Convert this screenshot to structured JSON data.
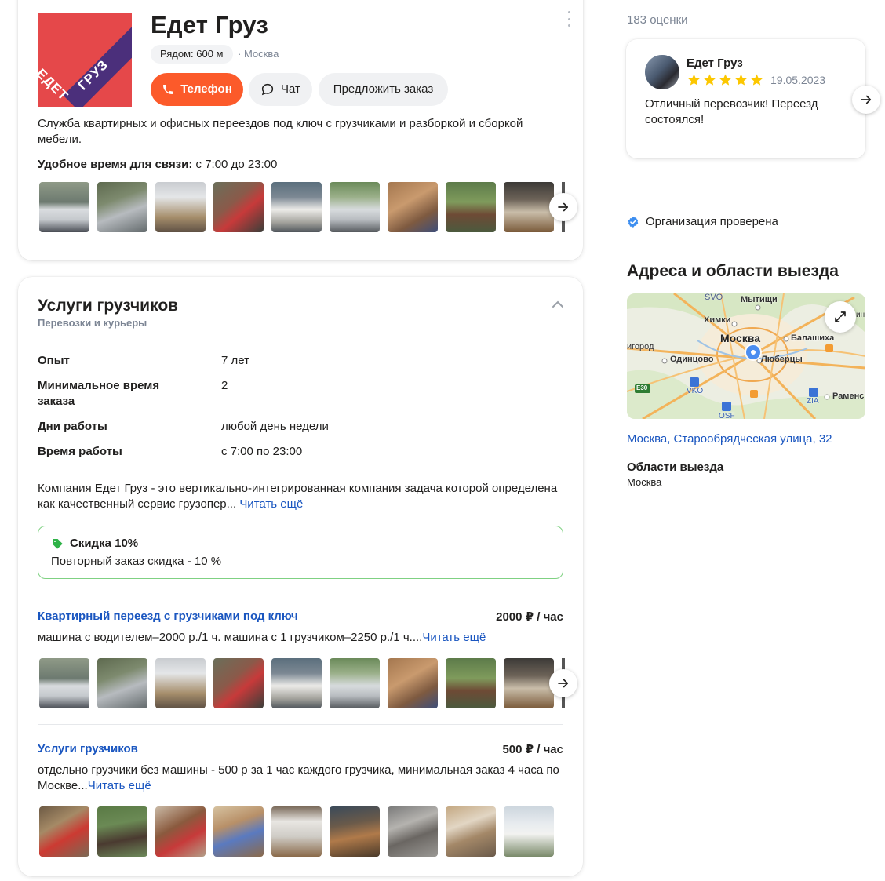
{
  "company": {
    "name": "Едет Груз",
    "logo_text_1": "ЕДЕТ",
    "logo_text_2": "ГРУЗ",
    "nearby": "Рядом: 600 м",
    "city": "· Москва",
    "description": "Служба квартирных и офисных переездов под ключ с грузчиками и разборкой и сборкой мебели.",
    "contact_time_label": "Удобное время для связи:",
    "contact_time_value": " с 7:00 до 23:00"
  },
  "actions": {
    "phone": "Телефон",
    "chat": "Чат",
    "order": "Предложить заказ"
  },
  "services_section": {
    "title": "Услуги грузчиков",
    "subtitle": "Перевозки и курьеры",
    "info": [
      {
        "key": "Опыт",
        "value": "7 лет"
      },
      {
        "key": "Минимальное время заказа",
        "value": "2"
      },
      {
        "key": "Дни работы",
        "value": "любой день недели"
      },
      {
        "key": "Время работы",
        "value": "с 7:00 по 23:00"
      }
    ],
    "about": "Компания Едет Груз - это вертикально-интегрированная компания задача которой определена как качественный сервис грузопер...",
    "read_more": "Читать ещё",
    "discount_title": "Скидка 10%",
    "discount_text": "Повторный заказ скидка - 10 %",
    "services": [
      {
        "name": "Квартирный переезд с грузчиками под ключ",
        "price": "2000 ₽ / час",
        "desc": "машина с водителем–2000 р./1 ч. машина с 1 грузчиком–2250 р./1 ч....",
        "read_more": "Читать ещё"
      },
      {
        "name": "Услуги грузчиков",
        "price": "500 ₽ / час",
        "desc": "отдельно грузчики без машины - 500 р за 1 час каждого грузчика, минимальная заказ 4 часа по Москве...",
        "read_more": "Читать ещё"
      }
    ]
  },
  "sidebar": {
    "ratings_count": "183 оценки",
    "review": {
      "author": "Едет Груз",
      "rating": 5,
      "date": "19.05.2023",
      "text": "Отличный перевозчик! Переезд состоялся!"
    },
    "verified": "Организация проверена",
    "address_title": "Адреса и области выезда",
    "address": "Москва, Старообрядческая улица, 32",
    "areas_title": "Области выезда",
    "areas_value": "Москва",
    "map_labels": [
      "SVO",
      "Мытищи",
      "Химки",
      "Москва",
      "Балашиха",
      "игород",
      "Одинцово",
      "Люберцы",
      "E30",
      "VKO",
      "ZIA",
      "Раменск",
      "OSF",
      "ин"
    ]
  },
  "colors": {
    "accent": "#fc5a2a",
    "link": "#1a56c0",
    "star": "#fcc700",
    "verified": "#3d8ef0",
    "discount": "#2eb247"
  }
}
